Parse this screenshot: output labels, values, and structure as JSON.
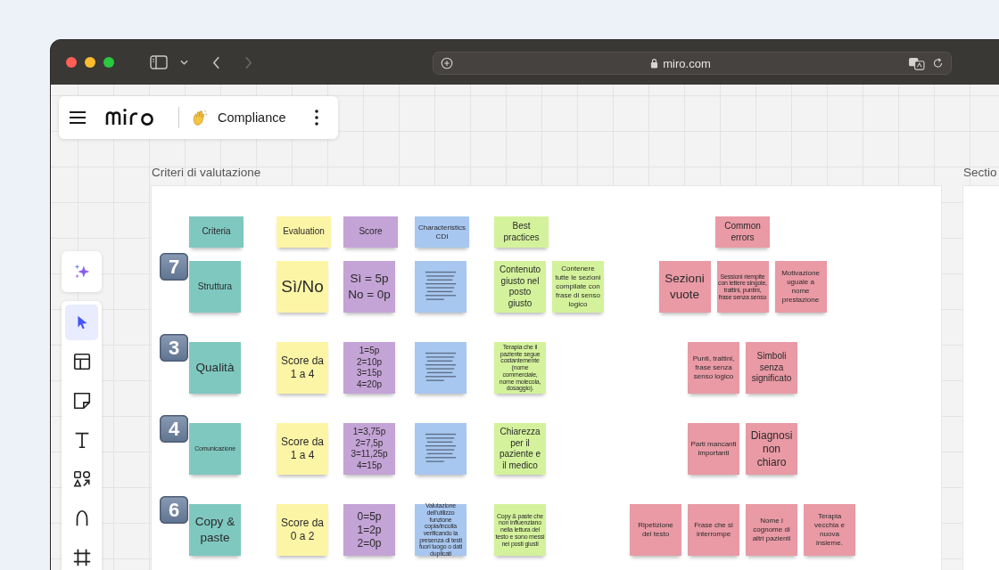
{
  "browser": {
    "url": "miro.com",
    "nav": [
      {
        "kind": "back",
        "disabled": false
      },
      {
        "kind": "forward",
        "disabled": true
      }
    ]
  },
  "board": {
    "title": "Compliance"
  },
  "toolbar": {
    "tools": [
      {
        "kind": "select",
        "selected": true
      },
      {
        "kind": "templates",
        "selected": false
      },
      {
        "kind": "sticky",
        "selected": false
      },
      {
        "kind": "text",
        "selected": false
      },
      {
        "kind": "shapes",
        "selected": false
      },
      {
        "kind": "pen",
        "selected": false
      },
      {
        "kind": "frame",
        "selected": false
      }
    ]
  },
  "frames": [
    {
      "title": "Criteri di valutazione"
    },
    {
      "title": "Sectio"
    }
  ],
  "rows": [
    {
      "notes": [
        {
          "text": "Criteria",
          "kind": "md",
          "color": "#7fc8c0"
        },
        {
          "text": "Evaluation",
          "kind": "md",
          "color": "#fdf5a6"
        },
        {
          "text": "Score",
          "kind": "md",
          "color": "#c4a3d6"
        },
        {
          "text": "Characteristics CDI",
          "kind": "sm",
          "color": "#a8c7f0"
        },
        {
          "text": "Best practices",
          "kind": "md",
          "color": "#d4f29c"
        }
      ],
      "errors": [
        {
          "text": "Common errors",
          "kind": "md",
          "color": "#e99aa5"
        }
      ]
    },
    {
      "badge": "7",
      "notes": [
        {
          "text": "Struttura",
          "kind": "md",
          "color": "#7fc8c0"
        },
        {
          "text": "Sì/No",
          "kind": "xl",
          "color": "#fdf5a6"
        },
        {
          "text": "Sì = 5p\nNo = 0p",
          "kind": "lg",
          "color": "#c4a3d6"
        },
        {
          "kind": "scribble",
          "color": "#a8c7f0"
        },
        {
          "text": "Contenuto giusto nel posto giusto",
          "kind": "md",
          "color": "#d4f29c"
        },
        {
          "text": "Contenere tutte le sezioni compilate con frase di senso logico",
          "kind": "sm",
          "color": "#d4f29c"
        }
      ],
      "errors": [
        {
          "text": "Sezioni vuote",
          "kind": "lg",
          "color": "#e99aa5"
        },
        {
          "text": "Sessioni riempite con lettere singole, trattini, puntini, frase senza senso",
          "kind": "xs",
          "color": "#e99aa5"
        },
        {
          "text": "Motivazione uguale a nome prestazione",
          "kind": "sm",
          "color": "#e99aa5"
        }
      ]
    },
    {
      "badge": "3",
      "notes": [
        {
          "text": "Qualità",
          "kind": "lg",
          "color": "#7fc8c0"
        },
        {
          "text": "Score da 1 a 4",
          "kind": "md2",
          "color": "#fdf5a6"
        },
        {
          "text": "1=5p\n2=10p\n3=15p\n4=20p",
          "kind": "md",
          "color": "#c4a3d6"
        },
        {
          "kind": "scribble",
          "color": "#a8c7f0"
        },
        {
          "text": "Terapia che il paziente segue costantemente (nome commerciale, nome molecola, dosaggio).",
          "kind": "xs",
          "color": "#d4f29c"
        }
      ],
      "errors": [
        {
          "text": "Punti, trattini, frase senza senso logico",
          "kind": "sm",
          "color": "#e99aa5"
        },
        {
          "text": "Simboli senza significato",
          "kind": "md",
          "color": "#e99aa5"
        }
      ]
    },
    {
      "badge": "4",
      "notes": [
        {
          "text": "Comunicazione",
          "kind": "xs",
          "color": "#7fc8c0"
        },
        {
          "text": "Score da 1 a 4",
          "kind": "md2",
          "color": "#fdf5a6"
        },
        {
          "text": "1=3,75p\n2=7,5p\n3=11,25p\n4=15p",
          "kind": "md",
          "color": "#c4a3d6"
        },
        {
          "kind": "scribble",
          "color": "#a8c7f0"
        },
        {
          "text": "Chiarezza per il paziente e il medico",
          "kind": "md",
          "color": "#d4f29c"
        }
      ],
      "errors": [
        {
          "text": "Parti mancanti importanti",
          "kind": "sm",
          "color": "#e99aa5"
        },
        {
          "text": "Diagnosi non chiaro",
          "kind": "md2",
          "color": "#e99aa5"
        }
      ]
    },
    {
      "badge": "6",
      "notes": [
        {
          "text": "Copy & paste",
          "kind": "lg",
          "color": "#7fc8c0"
        },
        {
          "text": "Score da 0 a 2",
          "kind": "md2",
          "color": "#fdf5a6"
        },
        {
          "text": "0=5p\n1=2p\n2=0p",
          "kind": "md2",
          "color": "#c4a3d6"
        },
        {
          "text": "Valutazione dell'utilizzo funzione copia/incolla verificando la presenza  di testi fuori luogo o dati duplicati",
          "kind": "xs",
          "color": "#a8c7f0"
        },
        {
          "text": "Copy & paste che non influenziano nella lettura del testo e sono messi nei posti giusti",
          "kind": "xs",
          "color": "#d4f29c"
        }
      ],
      "errors": [
        {
          "text": "Ripetizione del testo",
          "kind": "sm",
          "color": "#e99aa5"
        },
        {
          "text": "Frase che si interrompe",
          "kind": "sm",
          "color": "#e99aa5"
        },
        {
          "text": "Nome i cognome di altri pazienti",
          "kind": "sm",
          "color": "#e99aa5"
        },
        {
          "text": "Terapia vecchia e nuova insieme.",
          "kind": "sm",
          "color": "#e99aa5"
        }
      ]
    }
  ]
}
